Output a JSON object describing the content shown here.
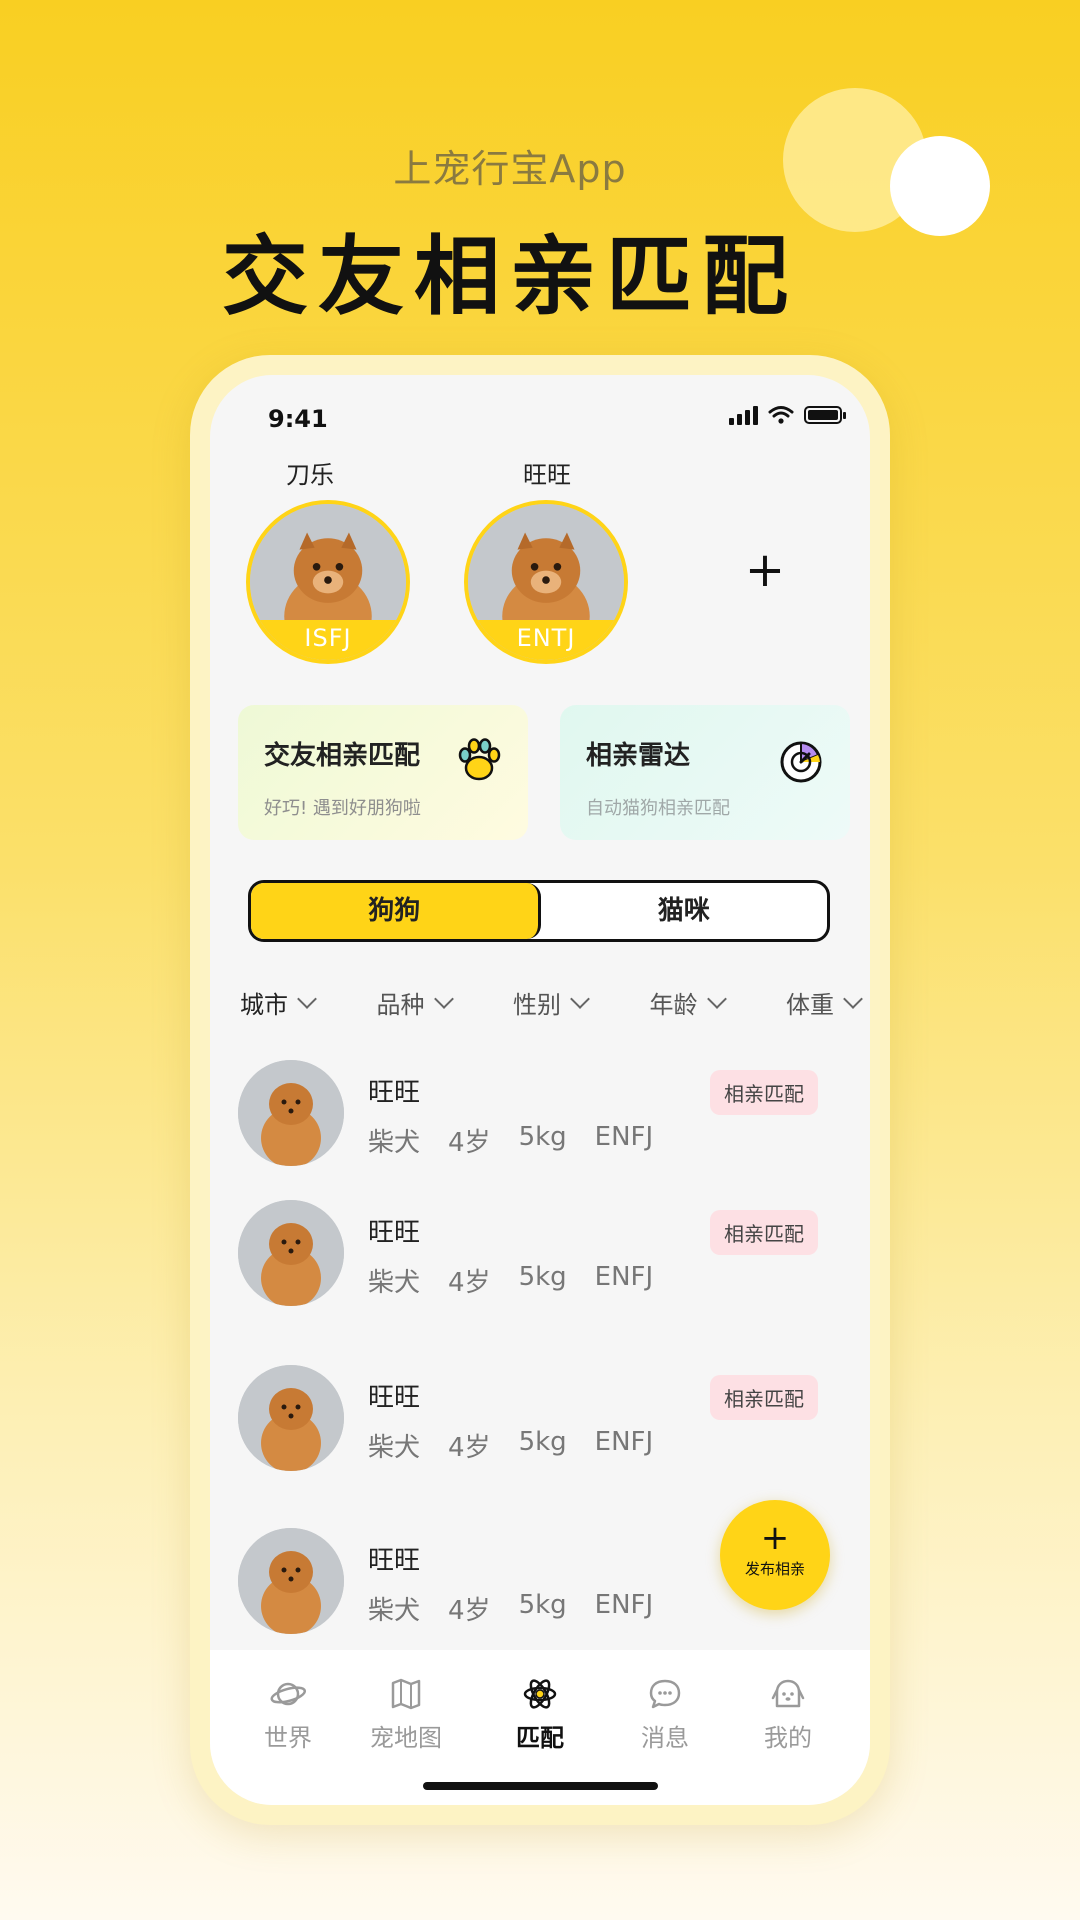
{
  "promo": {
    "subtitle": "上宠行宝App",
    "title": "交友相亲匹配"
  },
  "status_bar": {
    "time": "9:41"
  },
  "my_pets": [
    {
      "name": "刀乐",
      "mbti": "ISFJ"
    },
    {
      "name": "旺旺",
      "mbti": "ENTJ"
    }
  ],
  "add_pet_label": "+",
  "feature_cards": [
    {
      "title": "交友相亲匹配",
      "subtitle": "好巧! 遇到好朋狗啦",
      "icon": "paw-icon"
    },
    {
      "title": "相亲雷达",
      "subtitle": "自动猫狗相亲匹配",
      "icon": "radar-icon"
    }
  ],
  "segment": {
    "options": [
      "狗狗",
      "猫咪"
    ],
    "selected": "狗狗"
  },
  "filters": [
    "城市",
    "品种",
    "性别",
    "年龄",
    "体重"
  ],
  "list": [
    {
      "name": "旺旺",
      "breed": "柴犬",
      "age": "4岁",
      "weight": "5kg",
      "mbti": "ENFJ",
      "tag": "相亲匹配"
    },
    {
      "name": "旺旺",
      "breed": "柴犬",
      "age": "4岁",
      "weight": "5kg",
      "mbti": "ENFJ",
      "tag": "相亲匹配"
    },
    {
      "name": "旺旺",
      "breed": "柴犬",
      "age": "4岁",
      "weight": "5kg",
      "mbti": "ENFJ",
      "tag": "相亲匹配"
    },
    {
      "name": "旺旺",
      "breed": "柴犬",
      "age": "4岁",
      "weight": "5kg",
      "mbti": "ENFJ"
    }
  ],
  "fab": {
    "icon_label": "+",
    "label": "发布相亲"
  },
  "tabs": [
    {
      "label": "世界",
      "icon": "planet-icon"
    },
    {
      "label": "宠地图",
      "icon": "map-icon"
    },
    {
      "label": "匹配",
      "icon": "atom-icon",
      "active": true
    },
    {
      "label": "消息",
      "icon": "chat-icon"
    },
    {
      "label": "我的",
      "icon": "dog-face-icon"
    }
  ],
  "colors": {
    "accent": "#ffd417",
    "tag_bg": "#fde0e4",
    "background_top": "#f9cf22"
  }
}
